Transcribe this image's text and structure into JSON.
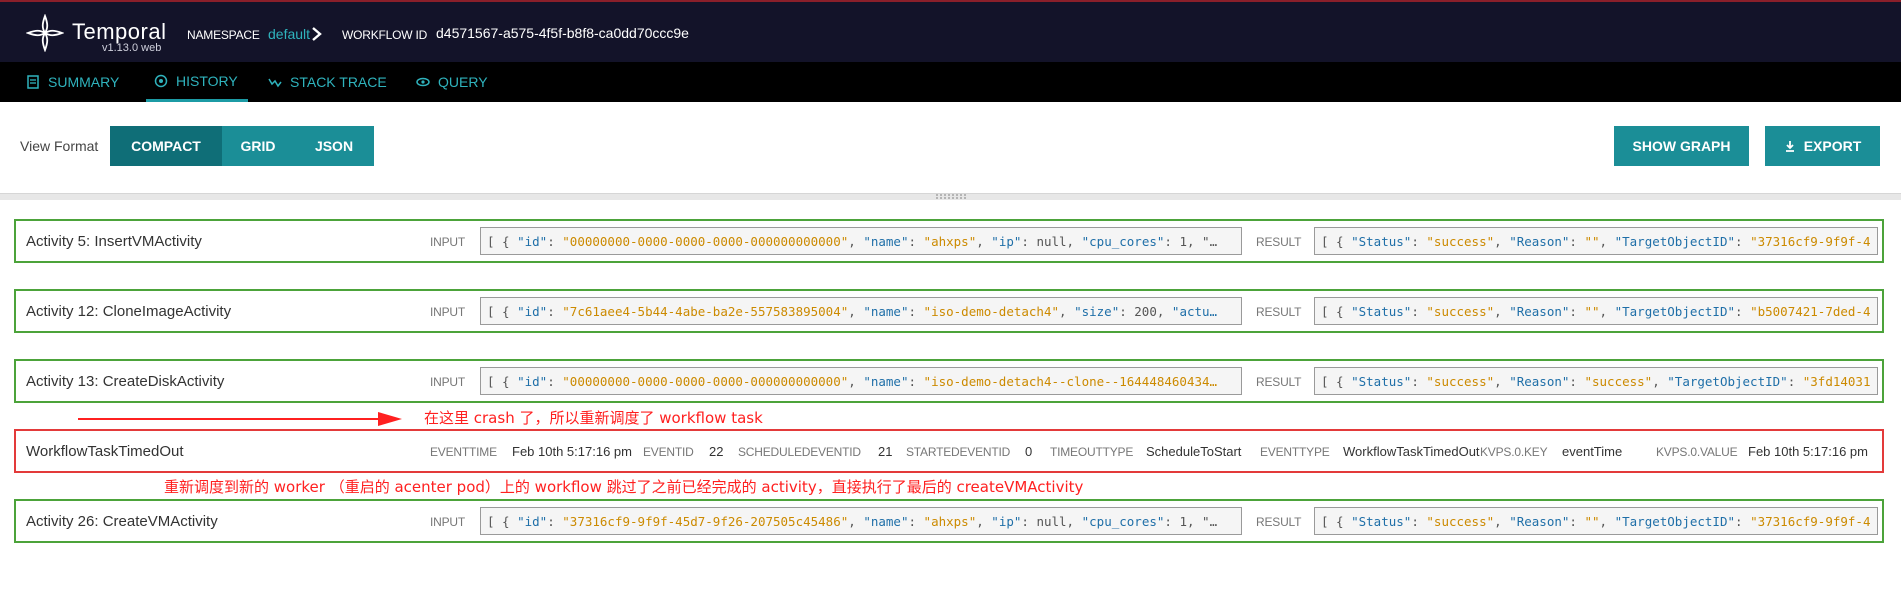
{
  "header": {
    "brand": "Temporal",
    "version": "v1.13.0 web",
    "namespace_label": "NAMESPACE",
    "namespace_value": "default",
    "workflow_id_label": "WORKFLOW ID",
    "workflow_id_value": "d4571567-a575-4f5f-b8f8-ca0dd70ccc9e"
  },
  "tabs": [
    {
      "label": "SUMMARY",
      "icon": "summary-icon",
      "active": false
    },
    {
      "label": "HISTORY",
      "icon": "history-icon",
      "active": true
    },
    {
      "label": "STACK TRACE",
      "icon": "stack-trace-icon",
      "active": false
    },
    {
      "label": "QUERY",
      "icon": "query-icon",
      "active": false
    }
  ],
  "view_format": {
    "label": "View Format",
    "options": [
      "COMPACT",
      "GRID",
      "JSON"
    ],
    "selected": "COMPACT"
  },
  "actions": {
    "show_graph": "SHOW GRAPH",
    "export": "EXPORT"
  },
  "events": [
    {
      "title": "Activity 5: InsertVMActivity",
      "input_label": "INPUT",
      "input": "[ { \"id\": \"00000000-0000-0000-0000-000000000000\", \"name\": \"ahxps\", \"ip\": null, \"cpu_cores\": 1, \"…",
      "result_label": "RESULT",
      "result": "[ { \"Status\": \"success\", \"Reason\": \"\", \"TargetObjectID\": \"37316cf9-9f9f-4"
    },
    {
      "title": "Activity 12: CloneImageActivity",
      "input_label": "INPUT",
      "input": "[ { \"id\": \"7c61aee4-5b44-4abe-ba2e-557583895004\", \"name\": \"iso-demo-detach4\", \"size\": 200, \"actu…",
      "result_label": "RESULT",
      "result": "[ { \"Status\": \"success\", \"Reason\": \"\", \"TargetObjectID\": \"b5007421-7ded-4"
    },
    {
      "title": "Activity 13: CreateDiskActivity",
      "input_label": "INPUT",
      "input": "[ { \"id\": \"00000000-0000-0000-0000-000000000000\", \"name\": \"iso-demo-detach4--clone--164448460434…",
      "result_label": "RESULT",
      "result": "[ { \"Status\": \"success\", \"Reason\": \"success\", \"TargetObjectID\": \"3fd14031"
    },
    {
      "title": "WorkflowTaskTimedOut",
      "fields": [
        {
          "key": "EVENTTIME",
          "value": "Feb 10th 5:17:16 pm"
        },
        {
          "key": "EVENTID",
          "value": "22"
        },
        {
          "key": "SCHEDULEDEVENTID",
          "value": "21"
        },
        {
          "key": "STARTEDEVENTID",
          "value": "0"
        },
        {
          "key": "TIMEOUTTYPE",
          "value": "ScheduleToStart"
        },
        {
          "key": "EVENTTYPE",
          "value": "WorkflowTaskTimedOut"
        },
        {
          "key": "KVPS.0.KEY",
          "value": "eventTime"
        },
        {
          "key": "KVPS.0.VALUE",
          "value": "Feb 10th 5:17:16 pm"
        }
      ]
    },
    {
      "title": "Activity 26: CreateVMActivity",
      "input_label": "INPUT",
      "input": "[ { \"id\": \"37316cf9-9f9f-45d7-9f26-207505c45486\", \"name\": \"ahxps\", \"ip\": null, \"cpu_cores\": 1, \"…",
      "result_label": "RESULT",
      "result": "[ { \"Status\": \"success\", \"Reason\": \"\", \"TargetObjectID\": \"37316cf9-9f9f-4"
    }
  ],
  "annotations": {
    "crash_note": "在这里 crash 了，所以重新调度了 workflow task",
    "reschedule_note": "重新调度到新的 worker （重启的 acenter pod）上的 workflow 跳过了之前已经完成的 activity，直接执行了最后的 createVMActivity"
  },
  "colors": {
    "header_bg": "#131329",
    "accent": "#1b8e97",
    "tab_text": "#2fb3bd",
    "success_border": "#4ca33a",
    "timeout_border": "#e33a3a",
    "annotation": "#ff2020"
  }
}
